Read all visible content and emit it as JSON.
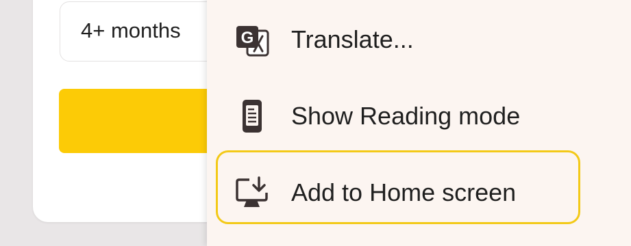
{
  "form": {
    "duration_value": "4+ months"
  },
  "menu": {
    "items": [
      {
        "label": "Translate...",
        "icon": "google-translate-icon"
      },
      {
        "label": "Show Reading mode",
        "icon": "reading-mode-icon"
      },
      {
        "label": "Add to Home screen",
        "icon": "add-to-home-screen-icon"
      }
    ],
    "focused_index": 2
  },
  "colors": {
    "accent_yellow": "#fccb06",
    "focus_ring": "#f3c917",
    "menu_background": "#fcf5f1",
    "icon_color": "#3b3232"
  }
}
